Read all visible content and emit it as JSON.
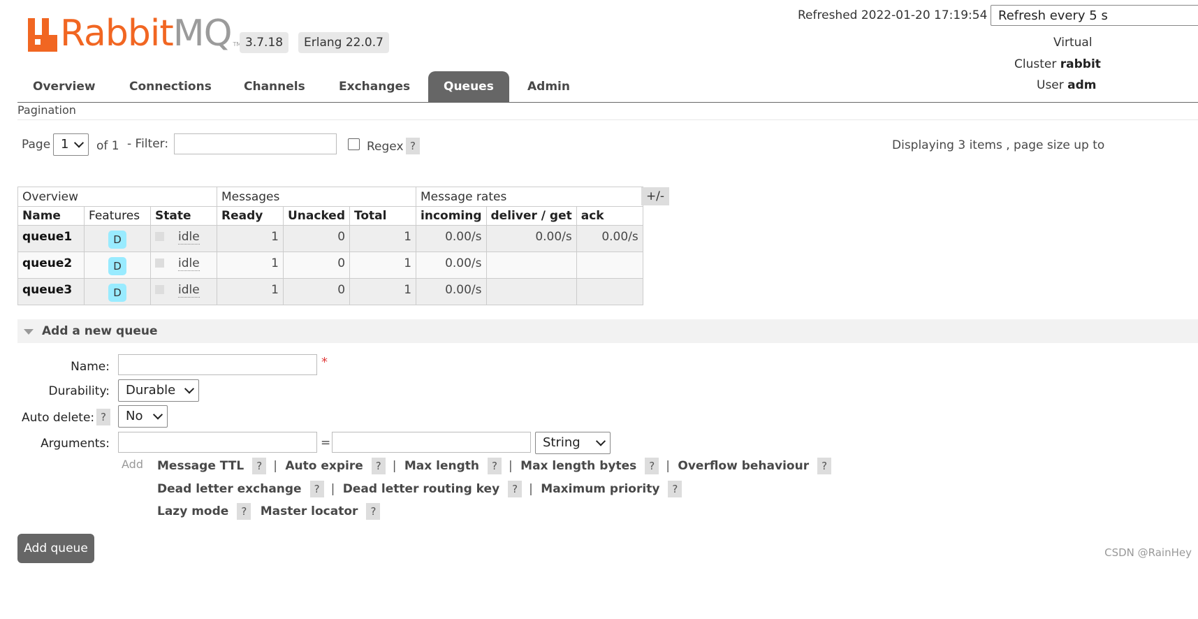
{
  "header": {
    "logo": {
      "text_part1": "Rabbit",
      "text_part2": "MQ",
      "tm": "TM"
    },
    "version": "3.7.18",
    "erlang": "Erlang 22.0.7",
    "refreshed": "Refreshed 2022-01-20 17:19:54",
    "refresh_select": "Refresh every 5 s",
    "virtual_host_label": "Virtual",
    "cluster_label": "Cluster",
    "cluster_value": "rabbit",
    "user_label": "User",
    "user_value": "adm"
  },
  "nav": {
    "tabs": [
      {
        "label": "Overview",
        "active": false
      },
      {
        "label": "Connections",
        "active": false
      },
      {
        "label": "Channels",
        "active": false
      },
      {
        "label": "Exchanges",
        "active": false
      },
      {
        "label": "Queues",
        "active": true
      },
      {
        "label": "Admin",
        "active": false
      }
    ]
  },
  "pagination": {
    "title": "Pagination",
    "page_label": "Page",
    "page_value": "1",
    "of_label": "of 1",
    "filter_label": "- Filter:",
    "filter_value": "",
    "regex_label": "Regex",
    "help": "?",
    "display_text": "Displaying 3 items , page size up to"
  },
  "table": {
    "groups": [
      "Overview",
      "Messages",
      "Message rates"
    ],
    "columns": [
      "Name",
      "Features",
      "State",
      "Ready",
      "Unacked",
      "Total",
      "incoming",
      "deliver / get",
      "ack"
    ],
    "plus_minus": "+/-",
    "rows": [
      {
        "name": "queue1",
        "feature": "D",
        "state": "idle",
        "ready": "1",
        "unacked": "0",
        "total": "1",
        "incoming": "0.00/s",
        "deliver_get": "0.00/s",
        "ack": "0.00/s"
      },
      {
        "name": "queue2",
        "feature": "D",
        "state": "idle",
        "ready": "1",
        "unacked": "0",
        "total": "1",
        "incoming": "0.00/s",
        "deliver_get": "",
        "ack": ""
      },
      {
        "name": "queue3",
        "feature": "D",
        "state": "idle",
        "ready": "1",
        "unacked": "0",
        "total": "1",
        "incoming": "0.00/s",
        "deliver_get": "",
        "ack": ""
      }
    ]
  },
  "add_queue": {
    "section_title": "Add a new queue",
    "name_label": "Name:",
    "name_value": "",
    "required_mark": "*",
    "durability_label": "Durability:",
    "durability_value": "Durable",
    "auto_delete_label": "Auto delete:",
    "auto_delete_value": "No",
    "arguments_label": "Arguments:",
    "equals": "=",
    "arg_type_value": "String",
    "add_label": "Add",
    "arg_links": {
      "message_ttl": "Message TTL",
      "auto_expire": "Auto expire",
      "max_length": "Max length",
      "max_length_bytes": "Max length bytes",
      "overflow_behaviour": "Overflow behaviour",
      "dead_letter_exchange": "Dead letter exchange",
      "dead_letter_routing_key": "Dead letter routing key",
      "maximum_priority": "Maximum priority",
      "lazy_mode": "Lazy mode",
      "master_locator": "Master locator"
    },
    "separator": "|",
    "submit_label": "Add queue"
  },
  "watermark": "CSDN @RainHey"
}
